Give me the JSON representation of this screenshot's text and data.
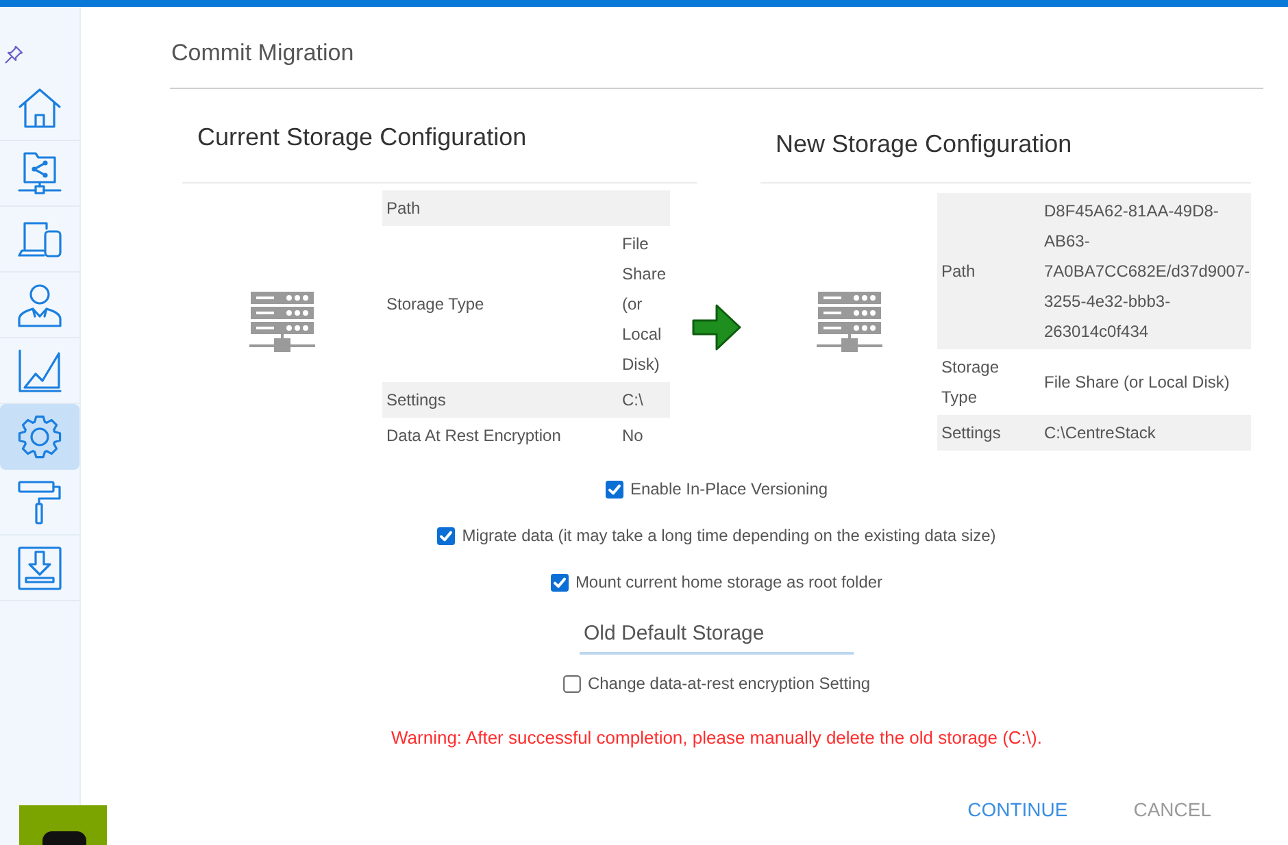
{
  "sidebar": {
    "items": [
      {
        "selected": false
      },
      {
        "selected": false
      },
      {
        "selected": false
      },
      {
        "selected": false
      },
      {
        "selected": false
      },
      {
        "selected": true
      },
      {
        "selected": false
      },
      {
        "selected": false
      }
    ]
  },
  "page": {
    "title": "Commit Migration"
  },
  "current_storage": {
    "heading": "Current Storage Configuration",
    "rows": [
      {
        "label": "Path"
      },
      {
        "label": "Storage Type",
        "value": "File Share (or Local Disk)"
      },
      {
        "label": "Settings",
        "value": "C:\\"
      },
      {
        "label": "Data At Rest Encryption",
        "value": "No"
      }
    ]
  },
  "new_storage": {
    "heading": "New Storage Configuration",
    "rows": [
      {
        "label": "Path",
        "value": "D8F45A62-81AA-49D8-AB63-7A0BA7CC682E/d37d9007-3255-4e32-bbb3-263014c0f434"
      },
      {
        "label": "Storage Type",
        "value": "File Share (or Local Disk)"
      },
      {
        "label": "Settings",
        "value": "C:\\CentreStack"
      }
    ]
  },
  "options": [
    {
      "label": "Enable In-Place Versioning",
      "checked": true
    },
    {
      "label": "Migrate data (it may take a long time depending on the existing data size)",
      "checked": true
    },
    {
      "label": "Mount current home storage as root folder",
      "checked": true
    }
  ],
  "storage_name_field": {
    "value": "Old Default Storage"
  },
  "encryption_option": {
    "label": "Change data-at-rest encryption Setting",
    "checked": false
  },
  "warning": "Warning: After successful completion, please manually delete the old storage (C:\\).",
  "buttons": [
    {
      "label": "CONTINUE",
      "kind": "primary"
    },
    {
      "label": "CANCEL",
      "kind": "secondary"
    }
  ]
}
